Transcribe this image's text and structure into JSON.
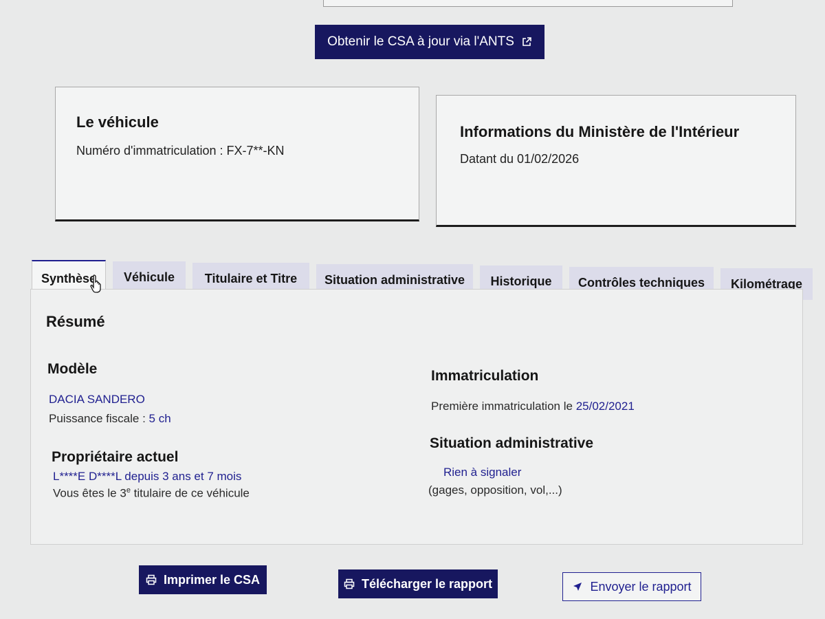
{
  "ants_button": {
    "label": "Obtenir le CSA à jour via l'ANTS",
    "icon": "external-link-icon"
  },
  "vehicle_card": {
    "title": "Le véhicule",
    "plate_text": "Numéro d'immatriculation : FX-7**-KN"
  },
  "ministry_card": {
    "title": "Informations du Ministère de l'Intérieur",
    "date_text": "Datant du 01/02/2026"
  },
  "tabs": [
    {
      "label": "Synthèse",
      "active": true
    },
    {
      "label": "Véhicule"
    },
    {
      "label": "Titulaire et Titre"
    },
    {
      "label": "Situation administrative"
    },
    {
      "label": "Historique"
    },
    {
      "label": "Contrôles techniques"
    },
    {
      "label": "Kilométrage"
    }
  ],
  "summary": {
    "title": "Résumé",
    "model": {
      "heading": "Modèle",
      "name": "DACIA SANDERO",
      "fiscal_label": "Puissance fiscale :",
      "fiscal_value": "5 ch"
    },
    "owner": {
      "heading": "Propriétaire actuel",
      "name": "L****E D****L",
      "since_label": "depuis",
      "since_value": "3 ans et 7 mois",
      "holder_prefix": "Vous êtes le 3",
      "holder_sup": "e",
      "holder_suffix": "titulaire de ce véhicule"
    },
    "registration": {
      "heading": "Immatriculation",
      "first_label": "Première immatriculation le",
      "first_value": "25/02/2021"
    },
    "admin": {
      "heading": "Situation administrative",
      "status": "Rien à signaler",
      "detail": "(gages, opposition, vol,...)"
    }
  },
  "actions": {
    "print": {
      "label": "Imprimer le CSA",
      "icon": "printer-icon"
    },
    "download": {
      "label": "Télécharger le rapport",
      "icon": "printer-icon"
    },
    "send": {
      "label": "Envoyer le rapport",
      "icon": "send-icon"
    }
  },
  "colors": {
    "primary": "#17175f",
    "link_blue": "#1f1f8f",
    "tab_bg": "#dcdcea",
    "page_bg": "#e9eaea"
  }
}
